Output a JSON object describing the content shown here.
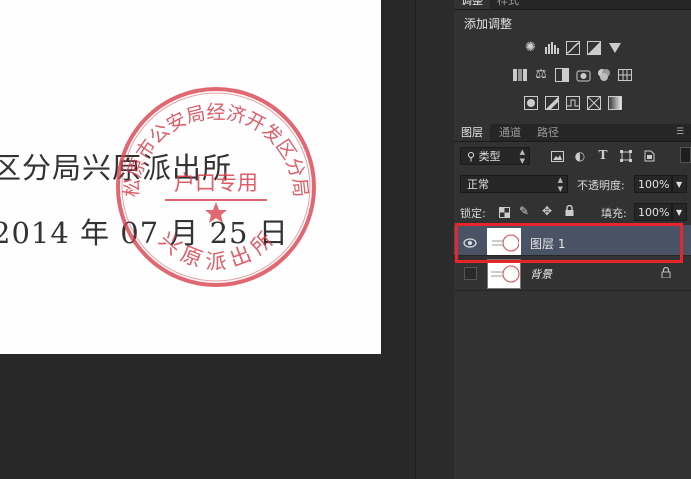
{
  "document": {
    "line1": "区分局兴原派出所",
    "line2": "2014 年 07 月 25 日",
    "stamp_ring_text": "松原市公安局经济开发区分局",
    "stamp_center_text": "户口专用",
    "stamp_bottom_text": "兴 原 派 出 所",
    "stamp_color": "#d9414e"
  },
  "adjustments_panel": {
    "tabs": [
      "调整",
      "样式"
    ],
    "title": "添加调整"
  },
  "layers_panel": {
    "tabs": [
      "图层",
      "通道",
      "路径"
    ],
    "filter_label": "类型",
    "blend_mode": "正常",
    "opacity_label": "不透明度:",
    "opacity_value": "100%",
    "lock_label": "锁定:",
    "fill_label": "填充:",
    "fill_value": "100%",
    "layers": [
      {
        "name": "图层 1",
        "selected": true,
        "visible": true,
        "locked": false
      },
      {
        "name": "背景",
        "selected": false,
        "visible": false,
        "locked": true
      }
    ]
  },
  "colors": {
    "panel_bg": "#323232",
    "selected_layer_bg": "#4a5366",
    "highlight_border": "#e6262c"
  }
}
